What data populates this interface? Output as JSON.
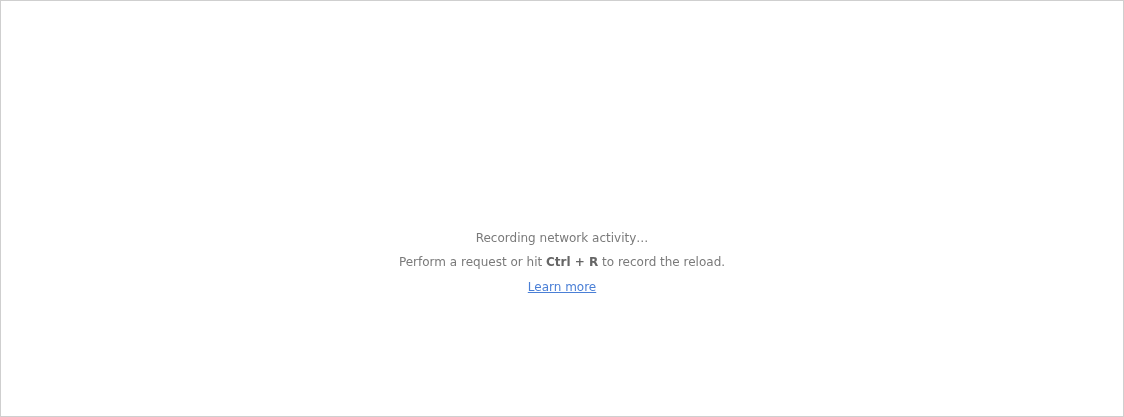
{
  "empty_state": {
    "title": "Recording network activity…",
    "hint": "Perform a request or hit **Ctrl + R** to record the reload.",
    "link": "Learn more"
  }
}
